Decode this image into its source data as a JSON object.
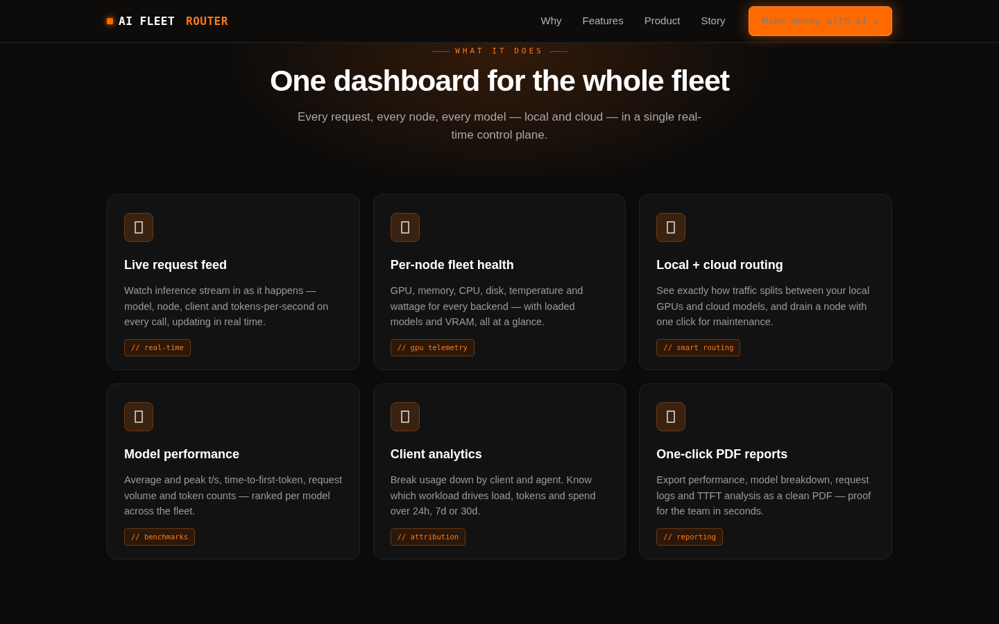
{
  "brand": {
    "name": "AI FLEET",
    "accent": "ROUTER"
  },
  "nav": {
    "links": [
      "Why",
      "Features",
      "Product",
      "Story"
    ],
    "cta": "Make money with AI ↗"
  },
  "hero": {
    "eyebrow": "WHAT IT DOES",
    "title": "One dashboard for the whole fleet",
    "subtitle": "Every request, every node, every model — local and cloud — in a single real-time control plane."
  },
  "features": [
    {
      "title": "Live request feed",
      "text": "Watch inference stream in as it happens — model, node, client and tokens-per-second on every call, updating in real time.",
      "tag": "// real-time"
    },
    {
      "title": "Per-node fleet health",
      "text": "GPU, memory, CPU, disk, temperature and wattage for every backend — with loaded models and VRAM, all at a glance.",
      "tag": "// gpu telemetry"
    },
    {
      "title": "Local + cloud routing",
      "text": "See exactly how traffic splits between your local GPUs and cloud models, and drain a node with one click for maintenance.",
      "tag": "// smart routing"
    },
    {
      "title": "Model performance",
      "text": "Average and peak t/s, time-to-first-token, request volume and token counts — ranked per model across the fleet.",
      "tag": "// benchmarks"
    },
    {
      "title": "Client analytics",
      "text": "Break usage down by client and agent. Know which workload drives load, tokens and spend over 24h, 7d or 30d.",
      "tag": "// attribution"
    },
    {
      "title": "One-click PDF reports",
      "text": "Export performance, model breakdown, request logs and TTFT analysis as a clean PDF — proof for the team in seconds.",
      "tag": "// reporting"
    }
  ]
}
